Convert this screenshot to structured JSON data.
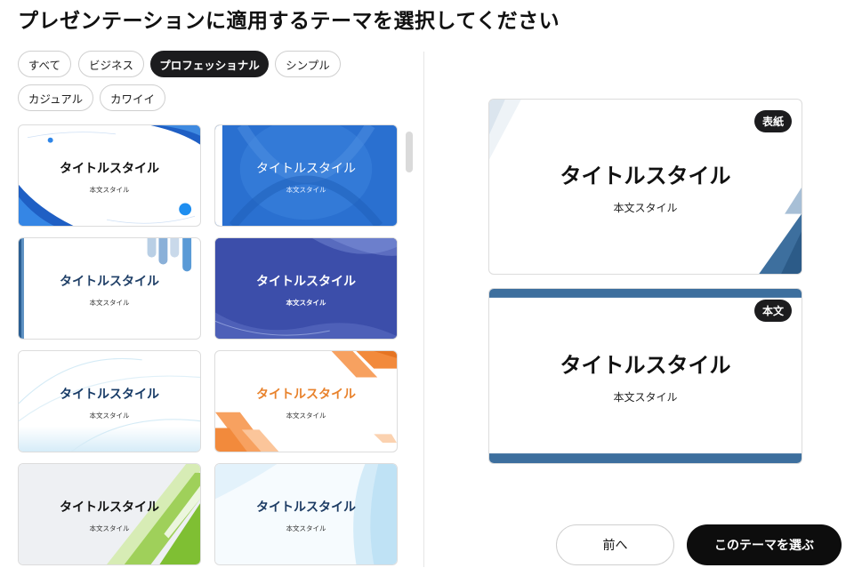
{
  "header": {
    "title": "プレゼンテーションに適用するテーマを選択してください"
  },
  "filters": [
    {
      "label": "すべて",
      "active": false
    },
    {
      "label": "ビジネス",
      "active": false
    },
    {
      "label": "プロフェッショナル",
      "active": true
    },
    {
      "label": "シンプル",
      "active": false
    },
    {
      "label": "カジュアル",
      "active": false
    },
    {
      "label": "カワイイ",
      "active": false
    }
  ],
  "themes": [
    {
      "title": "タイトルスタイル",
      "body": "本文スタイル",
      "title_color": "#111111"
    },
    {
      "title": "タイトルスタイル",
      "body": "本文スタイル",
      "title_color": "#ffffff"
    },
    {
      "title": "タイトルスタイル",
      "body": "本文スタイル",
      "title_color": "#1f3f67"
    },
    {
      "title": "タイトルスタイル",
      "body": "本文スタイル",
      "title_color": "#ffffff"
    },
    {
      "title": "タイトルスタイル",
      "body": "本文スタイル",
      "title_color": "#163a66"
    },
    {
      "title": "タイトルスタイル",
      "body": "本文スタイル",
      "title_color": "#e8822c"
    },
    {
      "title": "タイトルスタイル",
      "body": "本文スタイル",
      "title_color": "#111111"
    },
    {
      "title": "タイトルスタイル",
      "body": "本文スタイル",
      "title_color": "#1c3b63"
    }
  ],
  "preview": {
    "cover": {
      "badge": "表紙",
      "title": "タイトルスタイル",
      "body": "本文スタイル"
    },
    "content": {
      "badge": "本文",
      "title": "タイトルスタイル",
      "body": "本文スタイル"
    }
  },
  "actions": {
    "prev_label": "前へ",
    "choose_label": "このテーマを選ぶ"
  },
  "colors": {
    "accent_dark": "#1c1c1e",
    "preview_blue": "#3d6f9e"
  }
}
